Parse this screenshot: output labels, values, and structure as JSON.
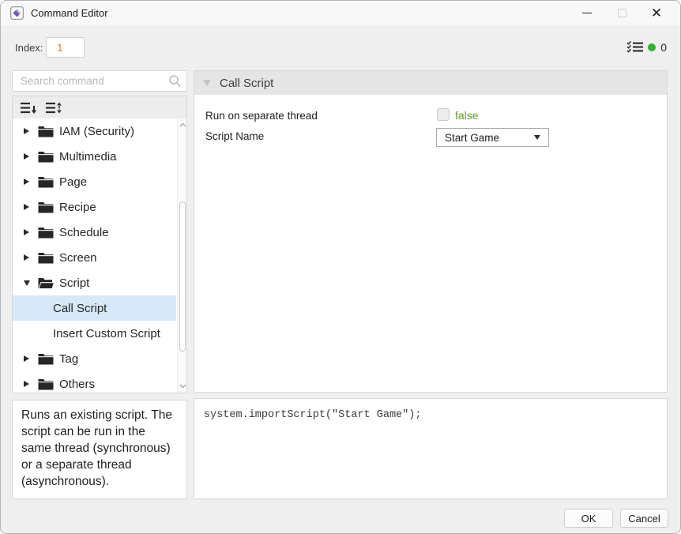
{
  "window": {
    "title": "Command Editor"
  },
  "topbar": {
    "index_label": "Index:",
    "index_value": "1",
    "error_count": "0",
    "status_dot_color": "#2db32d"
  },
  "sidebar": {
    "search_placeholder": "Search command",
    "tree": [
      {
        "label": "IAM (Security)",
        "type": "folder",
        "state": "collapsed",
        "selected": false
      },
      {
        "label": "Multimedia",
        "type": "folder",
        "state": "collapsed",
        "selected": false
      },
      {
        "label": "Page",
        "type": "folder",
        "state": "collapsed",
        "selected": false
      },
      {
        "label": "Recipe",
        "type": "folder",
        "state": "collapsed",
        "selected": false
      },
      {
        "label": "Schedule",
        "type": "folder",
        "state": "collapsed",
        "selected": false
      },
      {
        "label": "Screen",
        "type": "folder",
        "state": "collapsed",
        "selected": false
      },
      {
        "label": "Script",
        "type": "folder",
        "state": "expanded",
        "selected": false
      },
      {
        "label": "Call Script",
        "type": "item",
        "selected": true
      },
      {
        "label": "Insert Custom Script",
        "type": "item",
        "selected": false
      },
      {
        "label": "Tag",
        "type": "folder",
        "state": "collapsed",
        "selected": false
      },
      {
        "label": "Others",
        "type": "folder",
        "state": "collapsed",
        "selected": false
      }
    ],
    "description": "Runs an existing script. The script can be run in the same thread (synchronous) or a separate thread (asynchronous)."
  },
  "editor": {
    "header": "Call Script",
    "fields": [
      {
        "label": "Run on separate thread",
        "type": "checkbox",
        "value": "false",
        "checked": false
      },
      {
        "label": "Script Name",
        "type": "dropdown",
        "value": "Start Game"
      }
    ],
    "code": "system.importScript(\"Start Game\");"
  },
  "footer": {
    "ok_label": "OK",
    "cancel_label": "Cancel"
  },
  "colors": {
    "selection": "#d7e9f9",
    "index_value": "#dd8640",
    "checkbox_value": "#5f9e1f",
    "status_dot": "#2db32d"
  }
}
